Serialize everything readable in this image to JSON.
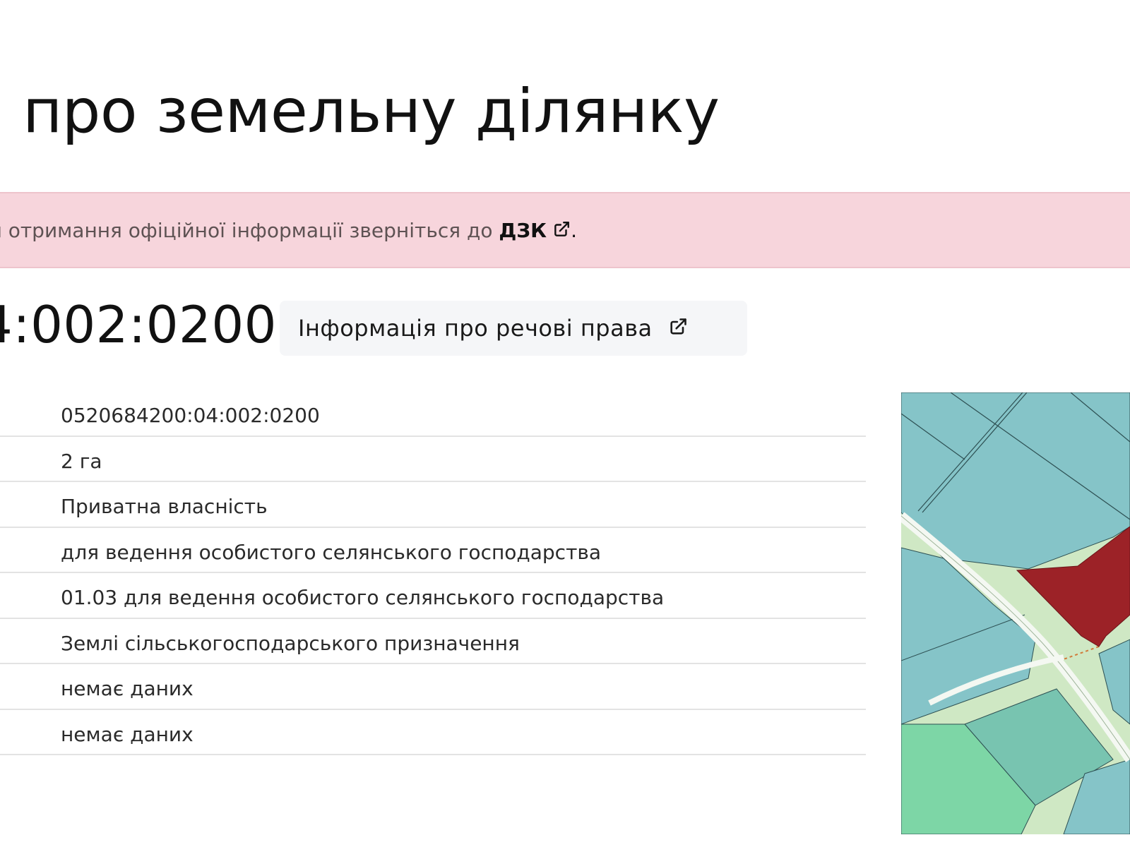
{
  "page": {
    "title": "я про земельну ділянку"
  },
  "alert": {
    "text": "я отримання офіційної інформації зверніться до ",
    "link_label": "ДЗК",
    "link_icon": "external-link-icon",
    "suffix": "."
  },
  "parcel": {
    "cadastral_number_visible": "4:002:0200",
    "rights_button_label": "Інформація про речові права",
    "rights_button_icon": "external-link-icon"
  },
  "details": {
    "values": [
      "0520684200:04:002:0200",
      "2 га",
      "Приватна власність",
      "для ведення особистого селянського господарства",
      "01.03 для ведення особистого селянського господарства",
      "Землі сільськогосподарського призначення",
      "немає даних",
      "немає даних"
    ]
  },
  "map": {
    "colors": {
      "parcel_fill": "#9c2227",
      "land_teal": "#85c4c8",
      "road_green": "#cfe8c4",
      "field_green": "#7dd6a6"
    }
  },
  "colors": {
    "alert_bg": "#f7d5dc",
    "button_bg": "#f5f6f8"
  }
}
